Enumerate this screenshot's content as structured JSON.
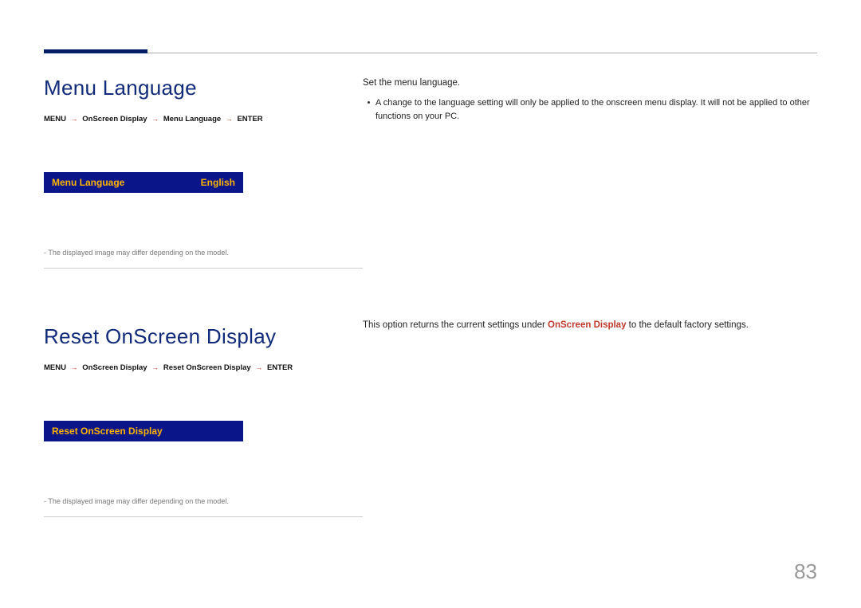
{
  "page_number": "83",
  "section1": {
    "title": "Menu Language",
    "breadcrumb": {
      "p1": "MENU",
      "p2": "OnScreen Display",
      "p3": "Menu Language",
      "p4": "ENTER"
    },
    "strip": {
      "label": "Menu Language",
      "value": "English"
    },
    "footnote": "The displayed image may differ depending on the model.",
    "right_intro": "Set the menu language.",
    "right_bullet": "A change to the language setting will only be applied to the onscreen menu display. It will not be applied to other functions on your PC."
  },
  "section2": {
    "title": "Reset OnScreen Display",
    "breadcrumb": {
      "p1": "MENU",
      "p2": "OnScreen Display",
      "p3": "Reset OnScreen Display",
      "p4": "ENTER"
    },
    "strip_label": "Reset OnScreen Display",
    "footnote": "The displayed image may differ depending on the model.",
    "right_a": "This option returns the current settings under ",
    "right_mid": "OnScreen Display",
    "right_b": " to the default factory settings."
  }
}
